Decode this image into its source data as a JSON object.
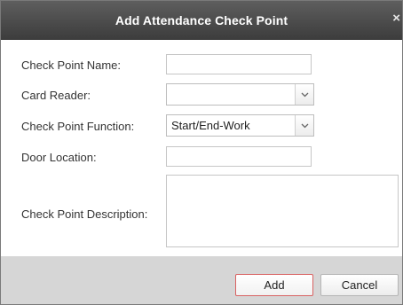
{
  "dialog": {
    "title": "Add Attendance Check Point",
    "close_glyph": "×"
  },
  "form": {
    "check_point_name": {
      "label": "Check Point Name:",
      "value": ""
    },
    "card_reader": {
      "label": "Card Reader:",
      "selected": ""
    },
    "check_point_function": {
      "label": "Check Point Function:",
      "selected": "Start/End-Work"
    },
    "door_location": {
      "label": "Door Location:",
      "value": ""
    },
    "check_point_description": {
      "label": "Check Point Description:",
      "value": ""
    }
  },
  "buttons": {
    "add_label": "Add",
    "cancel_label": "Cancel"
  },
  "icons": {
    "close": "close-icon",
    "dropdown": "chevron-down-icon"
  },
  "colors": {
    "titlebar": "#4a4a4a",
    "footer": "#d6d6d6",
    "add_border": "#d86262"
  }
}
